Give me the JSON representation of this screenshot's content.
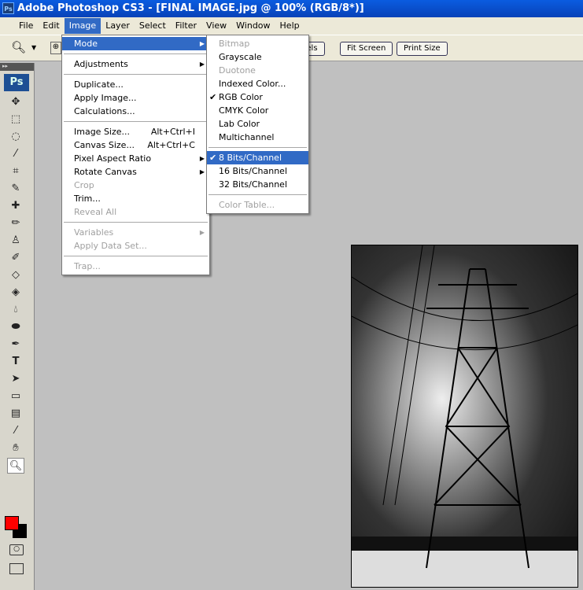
{
  "title": "Adobe Photoshop CS3 - [FINAL IMAGE.jpg @ 100% (RGB/8*)]",
  "app_icon": "Ps",
  "menubar": [
    "File",
    "Edit",
    "Image",
    "Layer",
    "Select",
    "Filter",
    "View",
    "Window",
    "Help"
  ],
  "options": {
    "actual_pixels": "ixels",
    "fit_screen": "Fit Screen",
    "print_size": "Print Size"
  },
  "toolbox": {
    "logo": "Ps",
    "fg_color": "#ff0000",
    "bg_color": "#000000"
  },
  "image_menu": {
    "mode": "Mode",
    "adjustments": "Adjustments",
    "duplicate": "Duplicate...",
    "apply_image": "Apply Image...",
    "calculations": "Calculations...",
    "image_size": "Image Size...",
    "image_size_sc": "Alt+Ctrl+I",
    "canvas_size": "Canvas Size...",
    "canvas_size_sc": "Alt+Ctrl+C",
    "pixel_aspect": "Pixel Aspect Ratio",
    "rotate_canvas": "Rotate Canvas",
    "crop": "Crop",
    "trim": "Trim...",
    "reveal_all": "Reveal All",
    "variables": "Variables",
    "apply_data_set": "Apply Data Set...",
    "trap": "Trap..."
  },
  "mode_menu": {
    "bitmap": "Bitmap",
    "grayscale": "Grayscale",
    "duotone": "Duotone",
    "indexed": "Indexed Color...",
    "rgb": "RGB Color",
    "cmyk": "CMYK Color",
    "lab": "Lab Color",
    "multichannel": "Multichannel",
    "bits8": "8 Bits/Channel",
    "bits16": "16 Bits/Channel",
    "bits32": "32 Bits/Channel",
    "color_table": "Color Table...",
    "check": "✔"
  }
}
